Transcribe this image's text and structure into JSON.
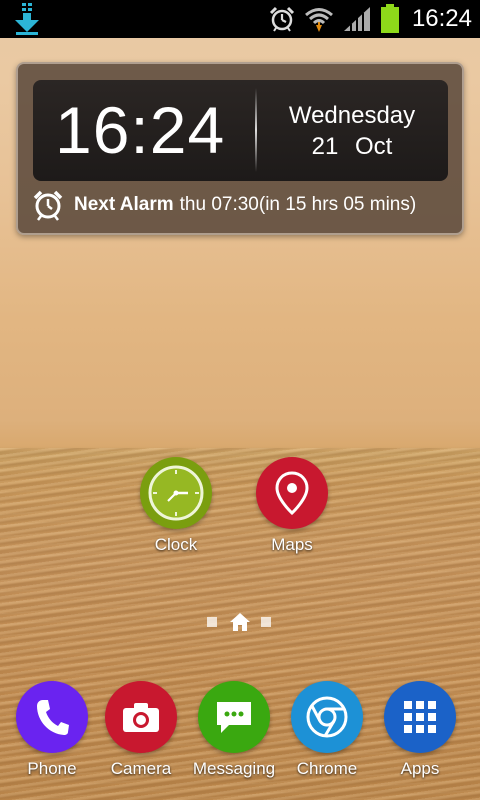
{
  "status_bar": {
    "time": "16:24",
    "icons": [
      "download-icon",
      "alarm-icon",
      "wifi-icon",
      "signal-icon",
      "battery-icon"
    ],
    "battery_color": "#8ed81a"
  },
  "clock_widget": {
    "time": "16:24",
    "day": "Wednesday",
    "date": "21 Oct",
    "alarm_label": "Next Alarm",
    "alarm_text": "thu 07:30(in 15 hrs 05 mins)"
  },
  "home_apps": [
    {
      "label": "Clock",
      "icon": "clock-icon",
      "color": "#7a9e0f"
    },
    {
      "label": "Maps",
      "icon": "map-pin-icon",
      "color": "#c8182f"
    }
  ],
  "page_indicator": {
    "pages": 3,
    "current": 2,
    "current_icon": "home-icon"
  },
  "dock": [
    {
      "label": "Phone",
      "icon": "phone-icon",
      "color": "#6a23f0"
    },
    {
      "label": "Camera",
      "icon": "camera-icon",
      "color": "#c8182f"
    },
    {
      "label": "Messaging",
      "icon": "messaging-icon",
      "color": "#3aa810"
    },
    {
      "label": "Chrome",
      "icon": "chrome-icon",
      "color": "#1d91d6"
    },
    {
      "label": "Apps",
      "icon": "apps-grid-icon",
      "color": "#1b62c8"
    }
  ]
}
